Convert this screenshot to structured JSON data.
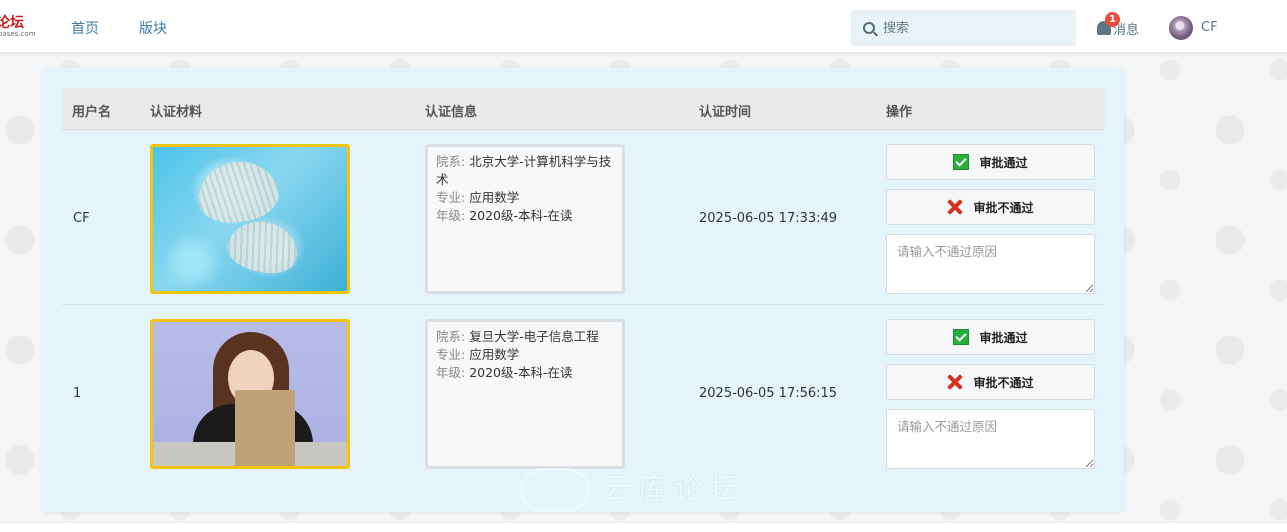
{
  "header": {
    "logo_text": "论坛",
    "logo_sub": "bases.com",
    "nav": [
      {
        "label": "首页"
      },
      {
        "label": "版块"
      }
    ],
    "search": {
      "placeholder": "搜索"
    },
    "messages": {
      "label": "消息",
      "badge": "1"
    },
    "user": {
      "name": "CF"
    }
  },
  "table": {
    "columns": [
      "用户名",
      "认证材料",
      "认证信息",
      "认证时间",
      "操作"
    ],
    "rows": [
      {
        "username": "CF",
        "photo": "seashells-image",
        "info": {
          "dept_key": "院系:",
          "dept_val": "北京大学-计算机科学与技术",
          "major_key": "专业:",
          "major_val": "应用数学",
          "grade_key": "年级:",
          "grade_val": "2020级-本科-在读"
        },
        "time": "2025-06-05 17:33:49",
        "approve_label": "审批通过",
        "reject_label": "审批不通过",
        "reason_placeholder": "请输入不通过原因"
      },
      {
        "username": "1",
        "photo": "person-holding-book-image",
        "info": {
          "dept_key": "院系:",
          "dept_val": "复旦大学-电子信息工程",
          "major_key": "专业:",
          "major_val": "应用数学",
          "grade_key": "年级:",
          "grade_val": "2020级-本科-在读"
        },
        "time": "2025-06-05 17:56:15",
        "approve_label": "审批通过",
        "reject_label": "审批不通过",
        "reason_placeholder": "请输入不通过原因"
      }
    ]
  },
  "watermark": {
    "text": "云库论坛"
  },
  "colors": {
    "accent": "#3a7ca5",
    "photo_border": "#f1c40f",
    "approve": "#27ae3c",
    "reject": "#d6331f",
    "card_bg": "#e5f4fb"
  }
}
